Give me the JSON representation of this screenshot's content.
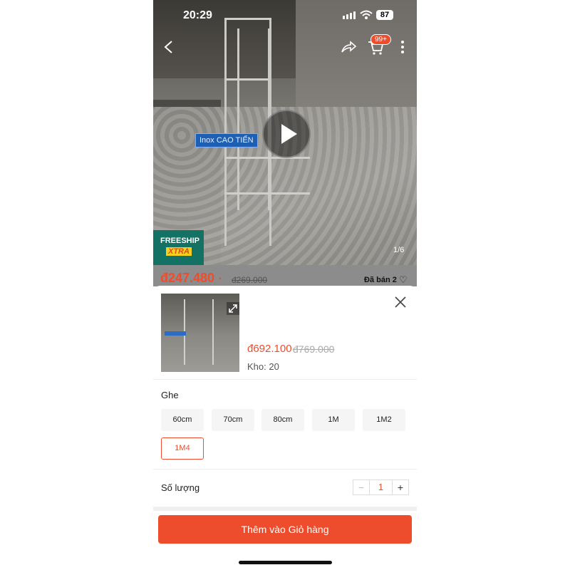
{
  "status_bar": {
    "time": "20:29",
    "battery": "87"
  },
  "cart": {
    "badge": "99+"
  },
  "media": {
    "watermark": "Inox CAO TIẾN",
    "counter": "1/6",
    "freeship_line1": "FREESHIP",
    "freeship_line2": "XTRA"
  },
  "listing": {
    "price": "đ247.480",
    "original_price": "đ269.000",
    "sold": "Đã bán 2"
  },
  "variant_sheet": {
    "price": "đ692.100",
    "original_price": "đ769.000",
    "stock": "Kho: 20",
    "group_title": "Ghe",
    "options": [
      "60cm",
      "70cm",
      "80cm",
      "1M",
      "1M2",
      "1M4"
    ],
    "selected_option": "1M4",
    "quantity_label": "Số lượng",
    "quantity": "1",
    "decrease_symbol": "−",
    "increase_symbol": "+",
    "add_to_cart": "Thêm vào Giỏ hàng"
  },
  "colors": {
    "accent": "#ee4d2d",
    "freeship_bg": "#137263",
    "freeship_tag": "#f7d21d"
  },
  "icons": [
    "back-arrow-icon",
    "share-icon",
    "cart-icon",
    "more-icon",
    "play-icon",
    "expand-icon",
    "close-icon",
    "heart-icon"
  ]
}
